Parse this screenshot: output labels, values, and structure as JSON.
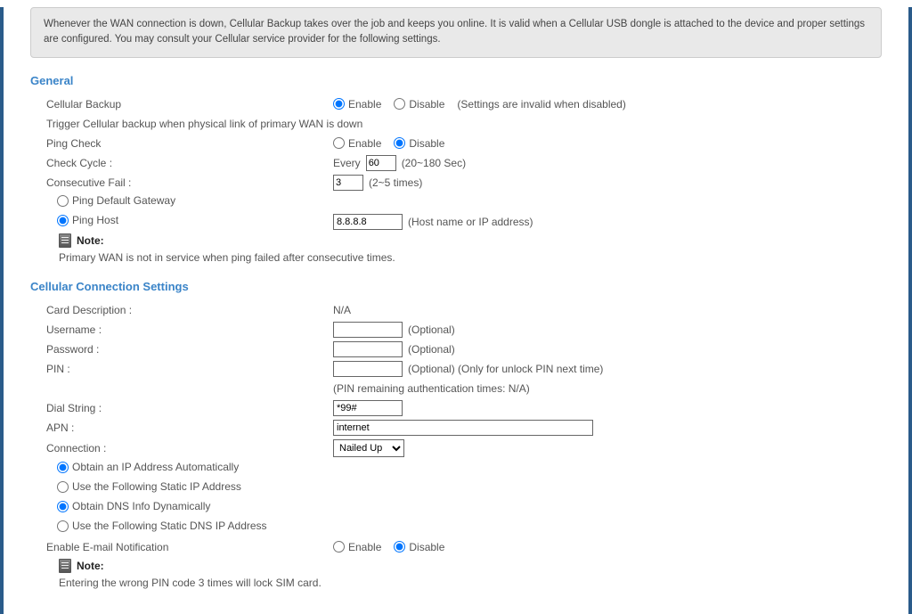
{
  "info_text": "Whenever the WAN connection is down, Cellular Backup takes over the job and keeps you online. It is valid when a Cellular USB dongle is attached to the device and proper settings are configured. You may consult your Cellular service provider for the following settings.",
  "general": {
    "title": "General",
    "cellular_backup_label": "Cellular Backup",
    "enable": "Enable",
    "disable": "Disable",
    "disabled_hint": "(Settings are invalid when disabled)",
    "trigger_text": "Trigger Cellular backup when physical link of primary WAN is down",
    "ping_check_label": "Ping Check",
    "check_cycle_label": "Check Cycle :",
    "check_cycle_prefix": "Every",
    "check_cycle_value": "60",
    "check_cycle_hint": "(20~180 Sec)",
    "consecutive_fail_label": "Consecutive Fail :",
    "consecutive_fail_value": "3",
    "consecutive_fail_hint": "(2~5 times)",
    "ping_default_gateway": "Ping Default Gateway",
    "ping_host": "Ping Host",
    "ping_host_value": "8.8.8.8",
    "ping_host_hint": "(Host name or IP address)",
    "note_label": "Note:",
    "note_text": "Primary WAN is not in service when ping failed after consecutive times."
  },
  "cellular": {
    "title": "Cellular Connection Settings",
    "card_desc_label": "Card Description :",
    "card_desc_value": "N/A",
    "username_label": "Username :",
    "username_value": "",
    "optional": "(Optional)",
    "password_label": "Password :",
    "password_value": "",
    "pin_label": "PIN :",
    "pin_value": "",
    "pin_hint": "(Optional) (Only for unlock PIN next time)",
    "pin_remaining": "(PIN remaining authentication times: N/A)",
    "dial_label": "Dial String :",
    "dial_value": "*99#",
    "apn_label": "APN :",
    "apn_value": "internet",
    "connection_label": "Connection :",
    "connection_value": "Nailed Up",
    "obtain_ip_auto": "Obtain an IP Address Automatically",
    "static_ip": "Use the Following Static IP Address",
    "obtain_dns_auto": "Obtain DNS Info Dynamically",
    "static_dns": "Use the Following Static DNS IP Address",
    "email_notif_label": "Enable E-mail Notification",
    "note_label": "Note:",
    "note_text": "Entering the wrong PIN code 3 times will lock SIM card."
  }
}
